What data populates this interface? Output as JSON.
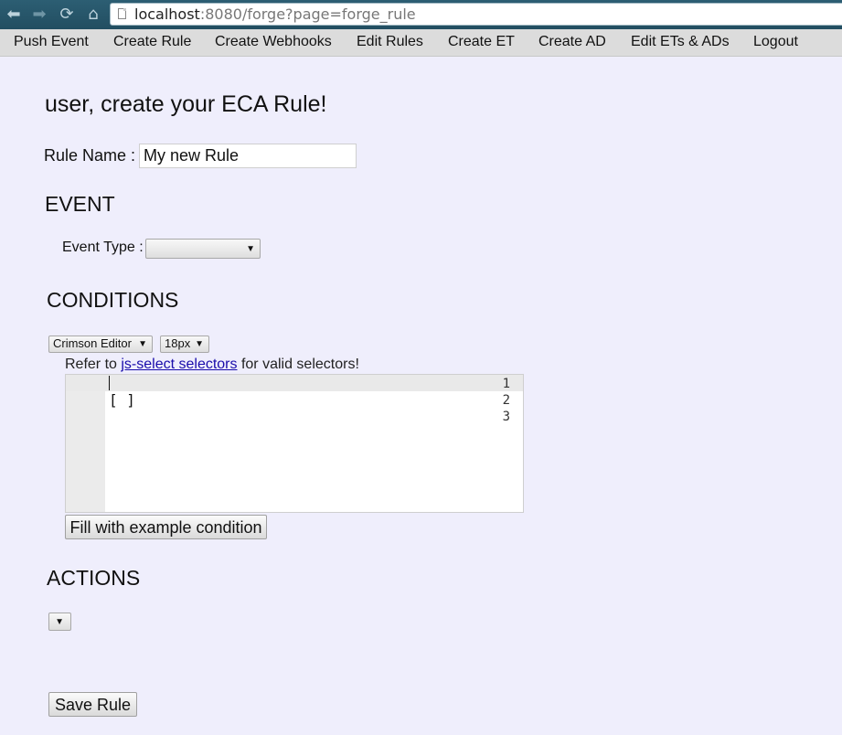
{
  "browser": {
    "url_host": "localhost",
    "url_rest": ":8080/forge?page=forge_rule"
  },
  "nav": {
    "items": [
      {
        "label": "Push Event"
      },
      {
        "label": "Create Rule"
      },
      {
        "label": "Create Webhooks"
      },
      {
        "label": "Edit Rules"
      },
      {
        "label": "Create ET"
      },
      {
        "label": "Create AD"
      },
      {
        "label": "Edit ETs & ADs"
      },
      {
        "label": "Logout"
      }
    ]
  },
  "page": {
    "title": "user, create your ECA Rule!",
    "rule_name_label": "Rule Name :",
    "rule_name_value": "My new Rule"
  },
  "event": {
    "heading": "EVENT",
    "type_label": "Event Type :",
    "type_selected": ""
  },
  "conditions": {
    "heading": "CONDITIONS",
    "theme_selected": "Crimson Editor",
    "font_size_selected": "18px",
    "refer_prefix": "Refer to ",
    "refer_link": "js-select selectors",
    "refer_suffix": " for valid selectors!",
    "editor_lines": [
      {
        "num": "1",
        "text": ""
      },
      {
        "num": "2",
        "text": "[ ]"
      },
      {
        "num": "3",
        "text": ""
      }
    ],
    "example_button": "Fill with example condition"
  },
  "actions": {
    "heading": "ACTIONS",
    "selected": ""
  },
  "save_button": "Save Rule",
  "icons": {
    "back": "arrow-left-icon",
    "forward": "arrow-right-icon",
    "reload": "reload-icon",
    "home": "home-icon",
    "page": "page-icon",
    "dropdown": "chevron-down-icon"
  }
}
